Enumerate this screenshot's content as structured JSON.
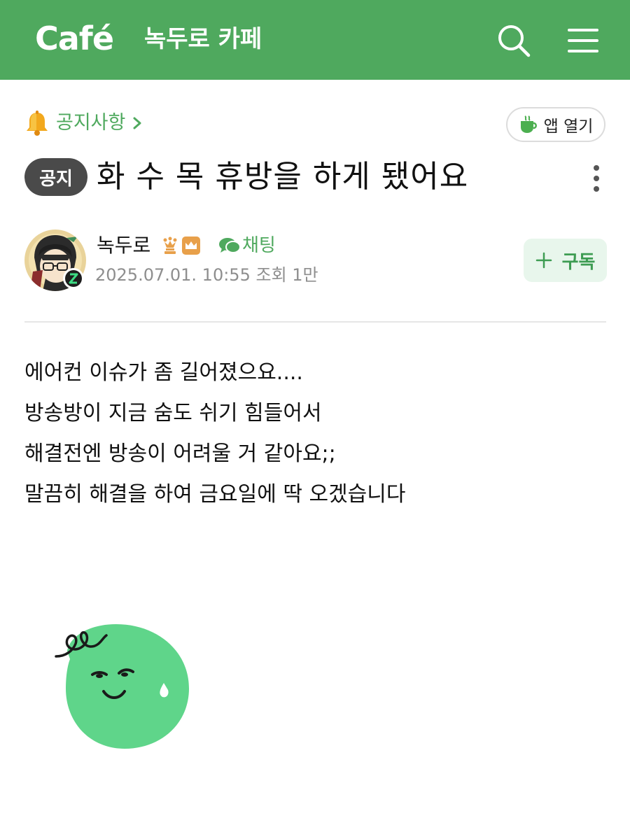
{
  "header": {
    "logo": "Café",
    "cafe_name": "녹두로 카페",
    "brand_color": "#4fa95e"
  },
  "breadcrumb": {
    "label": "공지사항",
    "icon": "bell-icon"
  },
  "app_open": {
    "label": "앱 열기",
    "icon": "coffee-cup-icon"
  },
  "post": {
    "badge": "공지",
    "title": "화 수 목 휴방을 하게 됐어요",
    "author": {
      "name": "녹두로",
      "chat_label": "채팅",
      "date": "2025.07.01. 10:55",
      "views": "조회 1만"
    },
    "subscribe_label": "구독",
    "body": [
      "에어컨 이슈가 좀 길어졌으요....",
      "방송방이 지금 숨도 쉬기 힘들어서",
      "해결전엔 방송이 어려울 거 같아요;;",
      "말끔히 해결을 하여 금요일에 딱 오겠습니다"
    ]
  }
}
